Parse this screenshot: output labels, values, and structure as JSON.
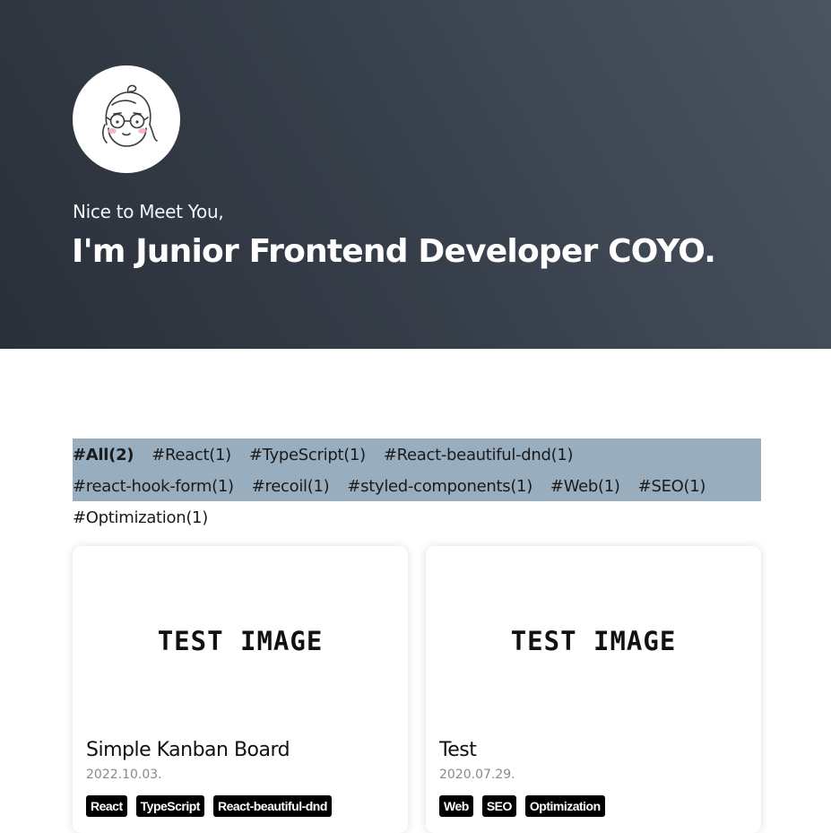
{
  "profile": {
    "greeting": "Nice to Meet You,",
    "headline": "I'm Junior Frontend Developer COYO."
  },
  "filters": [
    {
      "label": "#All(2)",
      "active": true
    },
    {
      "label": "#React(1)",
      "active": false
    },
    {
      "label": "#TypeScript(1)",
      "active": false
    },
    {
      "label": "#React-beautiful-dnd(1)",
      "active": false
    },
    {
      "label": "#react-hook-form(1)",
      "active": false
    },
    {
      "label": "#recoil(1)",
      "active": false
    },
    {
      "label": "#styled-components(1)",
      "active": false
    },
    {
      "label": "#Web(1)",
      "active": false
    },
    {
      "label": "#SEO(1)",
      "active": false
    },
    {
      "label": "#Optimization(1)",
      "active": false
    }
  ],
  "posts": [
    {
      "thumbnail_text": "TEST IMAGE",
      "title": "Simple Kanban Board",
      "date": "2022.10.03.",
      "tags": [
        "React",
        "TypeScript",
        "React-beautiful-dnd"
      ]
    },
    {
      "thumbnail_text": "TEST IMAGE",
      "title": "Test",
      "date": "2020.07.29.",
      "tags": [
        "Web",
        "SEO",
        "Optimization"
      ]
    }
  ],
  "colors": {
    "hero_gradient": [
      "#2a303a",
      "#4a5562"
    ],
    "filter_background": "#98aebf",
    "tag_background": "#000000"
  }
}
